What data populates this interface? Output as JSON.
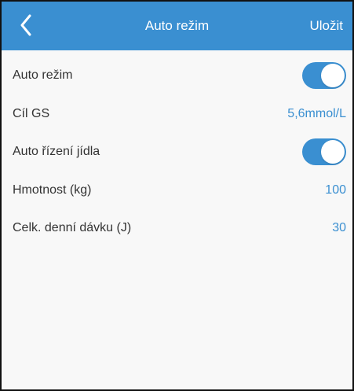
{
  "navbar": {
    "title": "Auto režim",
    "save_label": "Uložit",
    "back_icon": "chevron-left-icon",
    "background_color": "#3a8fd1"
  },
  "settings": {
    "auto_mode": {
      "label": "Auto režim",
      "enabled": true
    },
    "target_bg": {
      "label": "Cíl GS",
      "value": "5,6mmol/L"
    },
    "auto_meal": {
      "label": "Auto řízení jídla",
      "enabled": true
    },
    "weight": {
      "label": "Hmotnost (kg)",
      "value": "100"
    },
    "total_daily_dose": {
      "label": "Celk. denní dávku (J)",
      "value": "30"
    }
  },
  "colors": {
    "accent": "#3a8fd1",
    "label_text": "#333333",
    "background": "#f8f8f8"
  }
}
